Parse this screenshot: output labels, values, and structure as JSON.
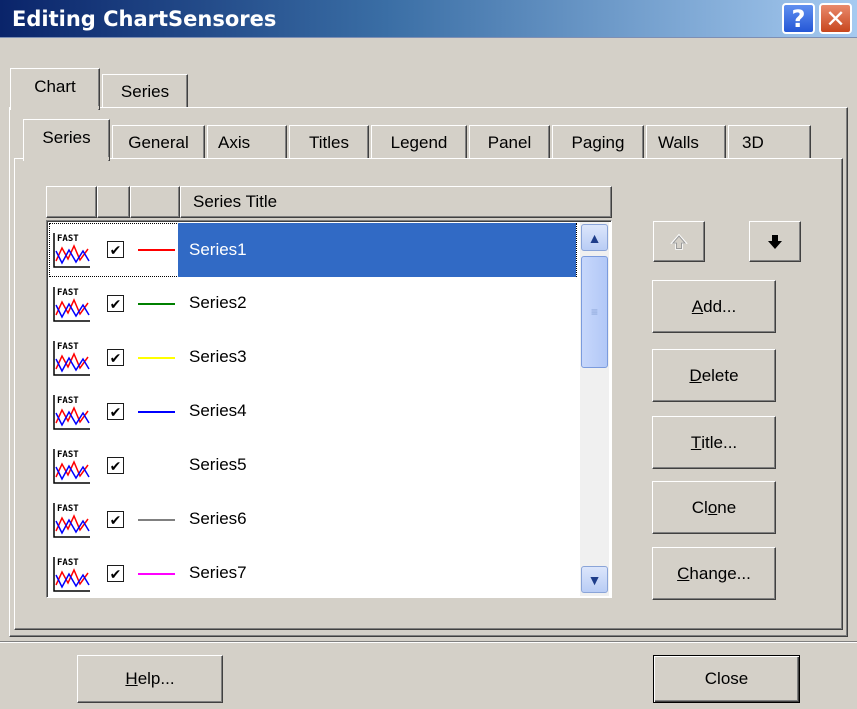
{
  "window": {
    "title": "Editing ChartSensores",
    "help_glyph": "?",
    "close_glyph": "✕"
  },
  "top_tabs": [
    {
      "label": "Chart"
    },
    {
      "label": "Series"
    }
  ],
  "sub_tabs": [
    {
      "label": "Series"
    },
    {
      "label": "General"
    },
    {
      "label": "Axis"
    },
    {
      "label": "Titles"
    },
    {
      "label": "Legend"
    },
    {
      "label": "Panel"
    },
    {
      "label": "Paging"
    },
    {
      "label": "Walls"
    },
    {
      "label": "3D"
    }
  ],
  "series_list": {
    "header": "Series Title",
    "rows": [
      {
        "name": "Series1",
        "checked": true,
        "color": "#ff0000",
        "selected": true
      },
      {
        "name": "Series2",
        "checked": true,
        "color": "#008000",
        "selected": false
      },
      {
        "name": "Series3",
        "checked": true,
        "color": "#ffff00",
        "selected": false
      },
      {
        "name": "Series4",
        "checked": true,
        "color": "#0000ff",
        "selected": false
      },
      {
        "name": "Series5",
        "checked": true,
        "color": "#ffffff",
        "selected": false
      },
      {
        "name": "Series6",
        "checked": true,
        "color": "#808080",
        "selected": false
      },
      {
        "name": "Series7",
        "checked": true,
        "color": "#ff00ff",
        "selected": false
      }
    ],
    "icon_label": "FAST",
    "check_glyph": "✔"
  },
  "side_buttons": {
    "move_up_icon": "up-arrow",
    "move_down_icon": "down-arrow",
    "add": {
      "pre": "",
      "ul": "A",
      "post": "dd..."
    },
    "delete": {
      "pre": "",
      "ul": "D",
      "post": "elete"
    },
    "title": {
      "pre": "",
      "ul": "T",
      "post": "itle..."
    },
    "clone": {
      "pre": "Cl",
      "ul": "o",
      "post": "ne"
    },
    "change": {
      "pre": "",
      "ul": "C",
      "post": "hange..."
    }
  },
  "bottom_buttons": {
    "help": {
      "pre": "",
      "ul": "H",
      "post": "elp..."
    },
    "close": "Close"
  },
  "colors": {
    "selection": "#316ac5",
    "face": "#d4d0c8"
  }
}
